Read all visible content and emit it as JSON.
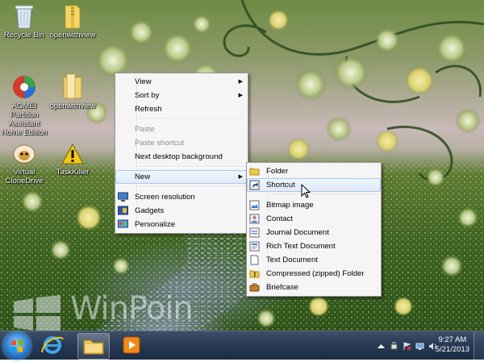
{
  "desktop": {
    "icons": [
      {
        "label": "Recycle Bin"
      },
      {
        "label": "openwithview"
      },
      {
        "label": "AOMEI Partition Assistant Home Edition"
      },
      {
        "label": "openwithview"
      },
      {
        "label": "Virtual CloneDrive"
      },
      {
        "label": "TaskKiller"
      }
    ]
  },
  "context_menu": {
    "items": [
      {
        "label": "View"
      },
      {
        "label": "Sort by"
      },
      {
        "label": "Refresh"
      },
      {
        "label": "Paste"
      },
      {
        "label": "Paste shortcut"
      },
      {
        "label": "Next desktop background"
      },
      {
        "label": "New"
      },
      {
        "label": "Screen resolution"
      },
      {
        "label": "Gadgets"
      },
      {
        "label": "Personalize"
      }
    ]
  },
  "new_submenu": {
    "items": [
      {
        "label": "Folder"
      },
      {
        "label": "Shortcut"
      },
      {
        "label": "Bitmap image"
      },
      {
        "label": "Contact"
      },
      {
        "label": "Journal Document"
      },
      {
        "label": "Rich Text Document"
      },
      {
        "label": "Text Document"
      },
      {
        "label": "Compressed (zipped) Folder"
      },
      {
        "label": "Briefcase"
      }
    ]
  },
  "watermark": {
    "text": "WinPoin"
  },
  "taskbar": {
    "pinned": [
      "internet-explorer-icon",
      "windows-explorer-icon",
      "media-player-icon"
    ],
    "clock": {
      "time": "9:27 AM",
      "date": "5/21/2013"
    }
  },
  "colors": {
    "menu_bg": "#f5f5f5",
    "highlight": "#dfeaf8",
    "taskbar": "#283a55"
  }
}
